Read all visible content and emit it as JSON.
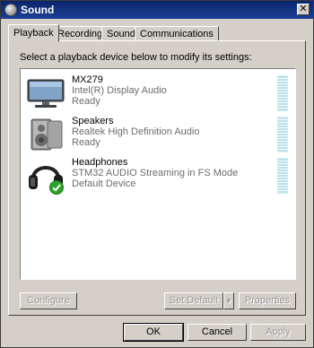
{
  "window": {
    "title": "Sound",
    "icon": "speaker-icon",
    "close_glyph": "✕"
  },
  "tabs": [
    {
      "label": "Playback",
      "active": true
    },
    {
      "label": "Recording",
      "active": false
    },
    {
      "label": "Sounds",
      "active": false
    },
    {
      "label": "Communications",
      "active": false
    }
  ],
  "instruction": "Select a playback device below to modify its settings:",
  "devices": [
    {
      "name": "MX279",
      "driver": "Intel(R) Display Audio",
      "status": "Ready",
      "icon": "monitor-icon"
    },
    {
      "name": "Speakers",
      "driver": "Realtek High Definition Audio",
      "status": "Ready",
      "icon": "speaker-icon"
    },
    {
      "name": "Headphones",
      "driver": "STM32 AUDIO Streaming in FS Mode",
      "status": "Default Device",
      "icon": "headphones-icon",
      "default_badge": "check-icon"
    }
  ],
  "panel_buttons": {
    "configure": "Configure",
    "set_default": "Set Default",
    "properties": "Properties"
  },
  "dialog_buttons": {
    "ok": "OK",
    "cancel": "Cancel",
    "apply": "Apply"
  },
  "colors": {
    "titlebar": "#0a246a",
    "meter": "#b8e0e8",
    "default_check": "#2ea12e"
  }
}
